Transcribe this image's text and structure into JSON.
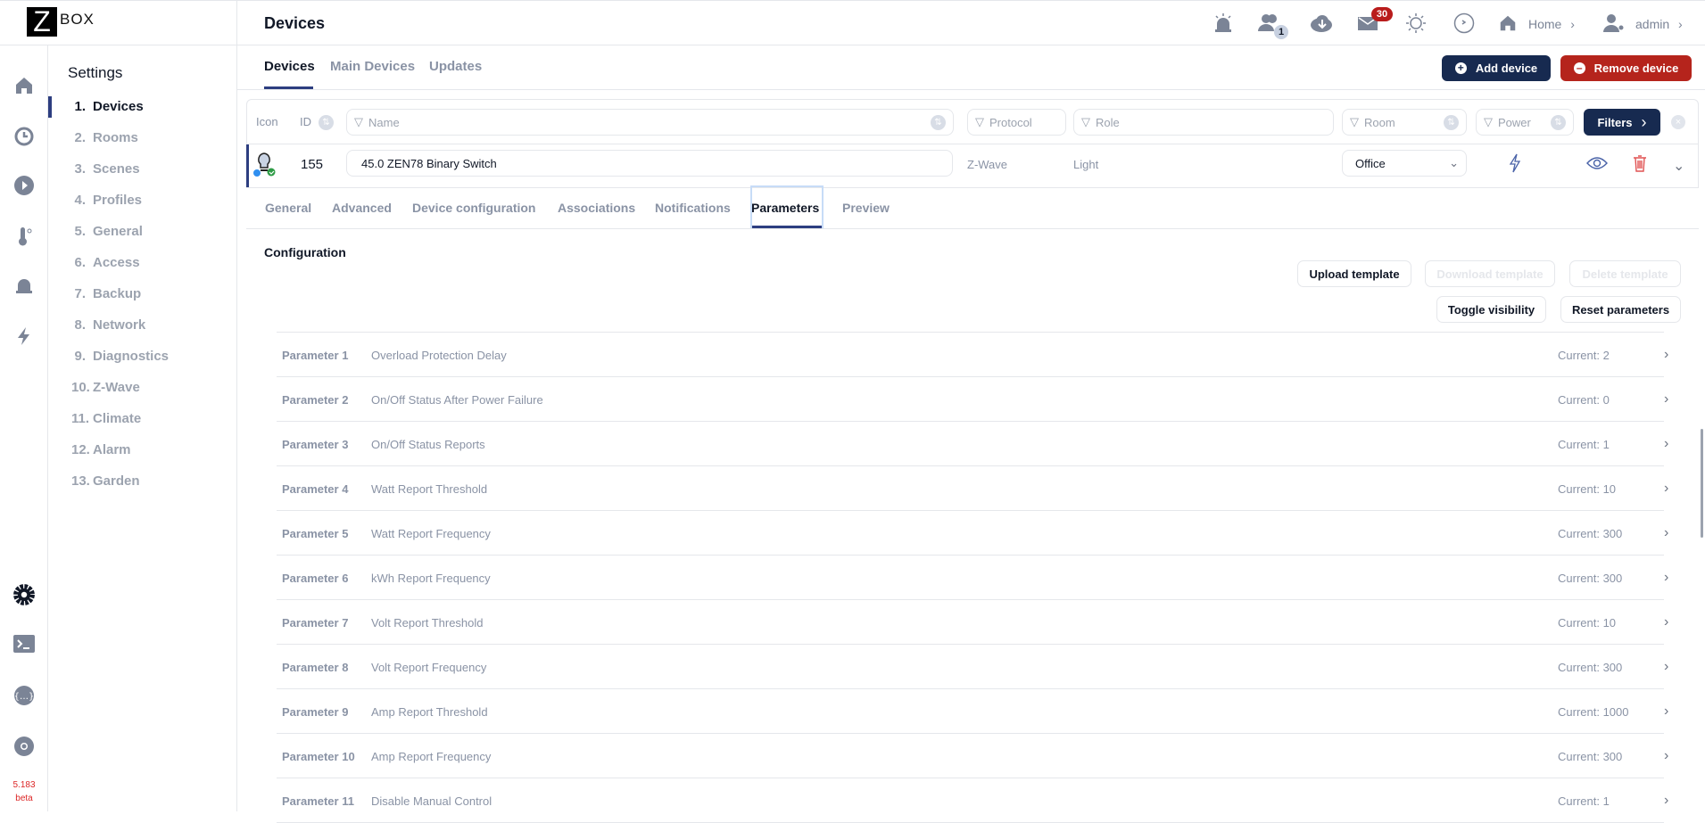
{
  "app": {
    "logo_letter": "Z",
    "logo_text": "BOX",
    "version": "5.183",
    "version_tag": "beta"
  },
  "header": {
    "title": "Devices",
    "users_badge": "1",
    "mail_badge": "30",
    "home_label": "Home",
    "user_label": "admin"
  },
  "settings": {
    "title": "Settings",
    "items": [
      {
        "num": "1.",
        "label": "Devices"
      },
      {
        "num": "2.",
        "label": "Rooms"
      },
      {
        "num": "3.",
        "label": "Scenes"
      },
      {
        "num": "4.",
        "label": "Profiles"
      },
      {
        "num": "5.",
        "label": "General"
      },
      {
        "num": "6.",
        "label": "Access"
      },
      {
        "num": "7.",
        "label": "Backup"
      },
      {
        "num": "8.",
        "label": "Network"
      },
      {
        "num": "9.",
        "label": "Diagnostics"
      },
      {
        "num": "10.",
        "label": "Z-Wave"
      },
      {
        "num": "11.",
        "label": "Climate"
      },
      {
        "num": "12.",
        "label": "Alarm"
      },
      {
        "num": "13.",
        "label": "Garden"
      }
    ]
  },
  "tabs": [
    "Devices",
    "Main Devices",
    "Updates"
  ],
  "actions": {
    "add": "Add device",
    "remove": "Remove device"
  },
  "filters": {
    "icon": "Icon",
    "id": "ID",
    "name": "Name",
    "protocol": "Protocol",
    "role": "Role",
    "room": "Room",
    "power": "Power",
    "button": "Filters"
  },
  "device": {
    "id": "155",
    "name": "45.0 ZEN78 Binary Switch",
    "protocol": "Z-Wave",
    "role": "Light",
    "room": "Office"
  },
  "subtabs": [
    "General",
    "Advanced",
    "Device configuration",
    "Associations",
    "Notifications",
    "Parameters",
    "Preview"
  ],
  "config": {
    "title": "Configuration",
    "upload": "Upload template",
    "download": "Download template",
    "delete": "Delete template",
    "toggle": "Toggle visibility",
    "reset": "Reset parameters"
  },
  "parameters": [
    {
      "label": "Parameter 1",
      "name": "Overload Protection Delay",
      "current": "Current: 2"
    },
    {
      "label": "Parameter 2",
      "name": "On/Off Status After Power Failure",
      "current": "Current: 0"
    },
    {
      "label": "Parameter 3",
      "name": "On/Off Status Reports",
      "current": "Current: 1"
    },
    {
      "label": "Parameter 4",
      "name": "Watt Report Threshold",
      "current": "Current: 10"
    },
    {
      "label": "Parameter 5",
      "name": "Watt Report Frequency",
      "current": "Current: 300"
    },
    {
      "label": "Parameter 6",
      "name": "kWh Report Frequency",
      "current": "Current: 300"
    },
    {
      "label": "Parameter 7",
      "name": "Volt Report Threshold",
      "current": "Current: 10"
    },
    {
      "label": "Parameter 8",
      "name": "Volt Report Frequency",
      "current": "Current: 300"
    },
    {
      "label": "Parameter 9",
      "name": "Amp Report Threshold",
      "current": "Current: 1000"
    },
    {
      "label": "Parameter 10",
      "name": "Amp Report Frequency",
      "current": "Current: 300"
    },
    {
      "label": "Parameter 11",
      "name": "Disable Manual Control",
      "current": "Current: 1"
    }
  ]
}
